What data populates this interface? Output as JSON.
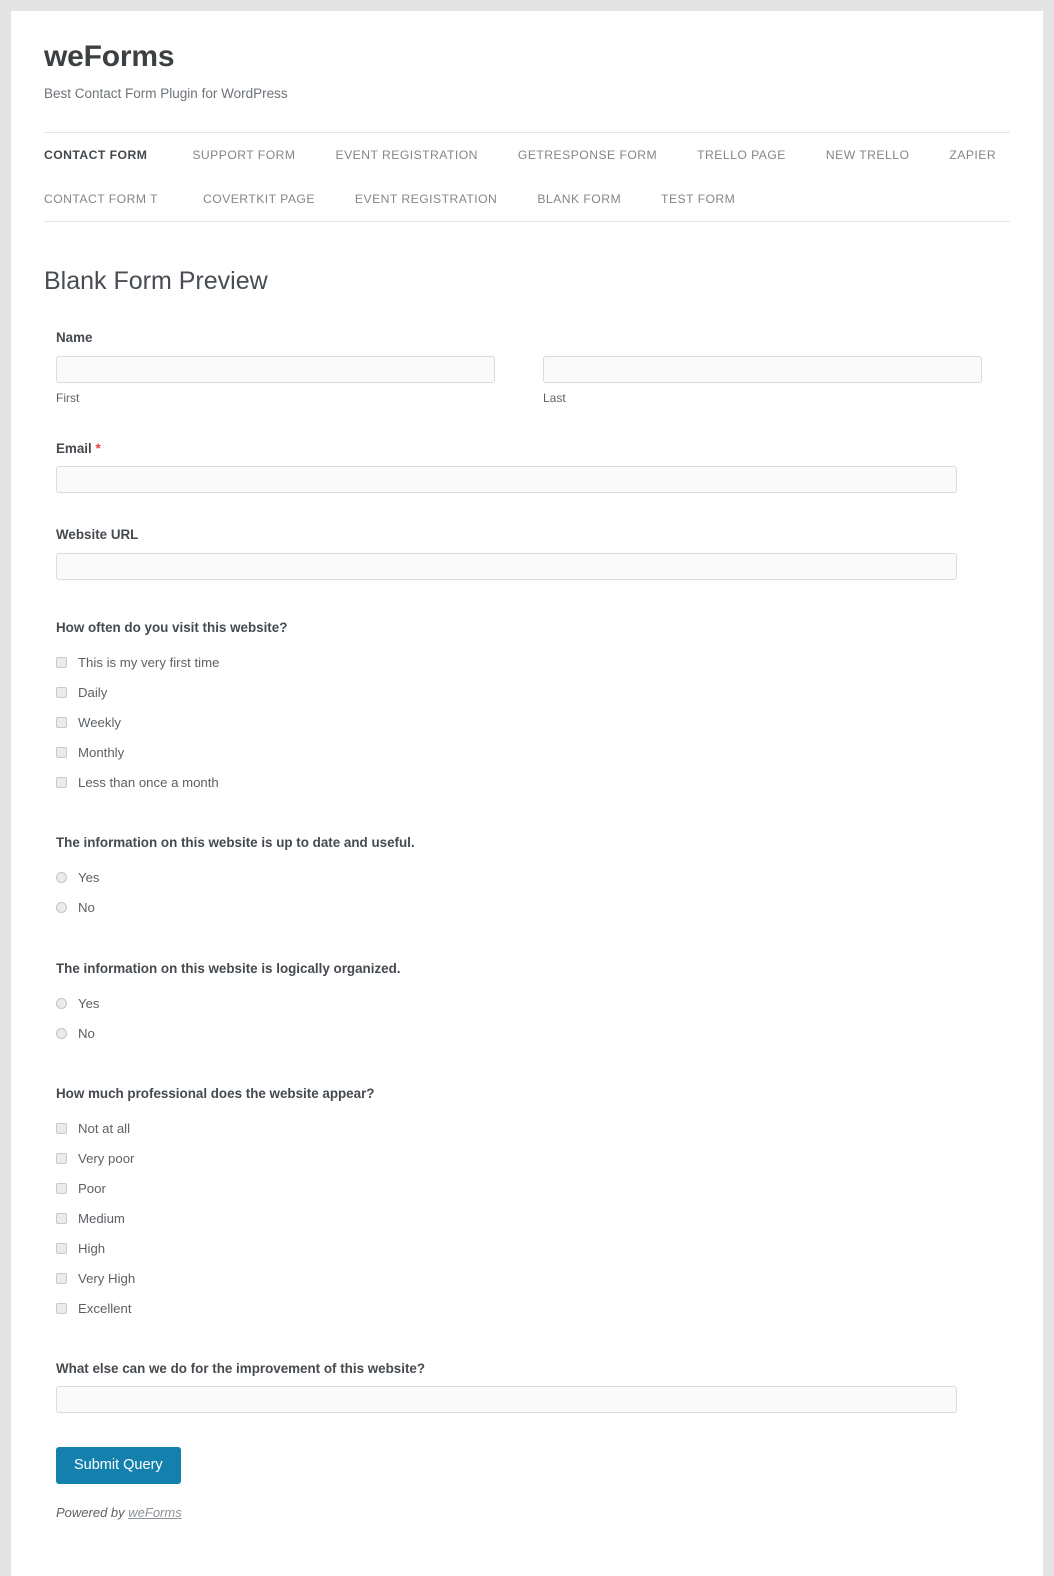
{
  "site": {
    "title": "weForms",
    "tagline": "Best Contact Form Plugin for WordPress"
  },
  "nav": {
    "row1": [
      {
        "label": "CONTACT FORM",
        "active": true
      },
      {
        "label": "SUPPORT FORM",
        "active": false
      },
      {
        "label": "EVENT REGISTRATION",
        "active": false
      },
      {
        "label": "GETRESPONSE FORM",
        "active": false
      },
      {
        "label": "TRELLO PAGE",
        "active": false
      },
      {
        "label": "NEW TRELLO",
        "active": false
      },
      {
        "label": "ZAPIER",
        "active": false
      }
    ],
    "row2": [
      {
        "label": "CONTACT FORM T",
        "active": false
      },
      {
        "label": "COVERTKIT PAGE",
        "active": false
      },
      {
        "label": "EVENT REGISTRATION",
        "active": false
      },
      {
        "label": "BLANK FORM",
        "active": false
      },
      {
        "label": "TEST FORM",
        "active": false
      }
    ]
  },
  "page": {
    "title": "Blank Form Preview"
  },
  "form": {
    "name": {
      "label": "Name",
      "first": {
        "sub_label": "First",
        "value": "",
        "placeholder": ""
      },
      "last": {
        "sub_label": "Last",
        "value": "",
        "placeholder": ""
      }
    },
    "email": {
      "label": "Email",
      "required_marker": "*",
      "value": "",
      "placeholder": ""
    },
    "website_url": {
      "label": "Website URL",
      "value": "",
      "placeholder": ""
    },
    "visit_frequency": {
      "label": "How often do you visit this website?",
      "type": "checkbox",
      "options": [
        "This is my very first time",
        "Daily",
        "Weekly",
        "Monthly",
        "Less than once a month"
      ]
    },
    "up_to_date": {
      "label": "The information on this website is up to date and useful.",
      "type": "radio",
      "options": [
        "Yes",
        "No"
      ]
    },
    "logically_organized": {
      "label": "The information on this website is logically organized.",
      "type": "radio",
      "options": [
        "Yes",
        "No"
      ]
    },
    "professional": {
      "label": "How much professional does the website appear?",
      "type": "checkbox",
      "options": [
        "Not at all",
        "Very poor",
        "Poor",
        "Medium",
        "High",
        "Very High",
        "Excellent"
      ]
    },
    "improvement": {
      "label": "What else can we do for the improvement of this website?",
      "value": "",
      "placeholder": ""
    },
    "submit_label": "Submit Query"
  },
  "footer": {
    "powered_prefix": "Powered by ",
    "powered_link": "weForms"
  },
  "colors": {
    "accent": "#1480ae",
    "required": "#ec3f3f",
    "page_background": "#e4e4e4",
    "content_background": "#ffffff",
    "input_background": "#fafafa",
    "border": "#dcdcdc"
  }
}
